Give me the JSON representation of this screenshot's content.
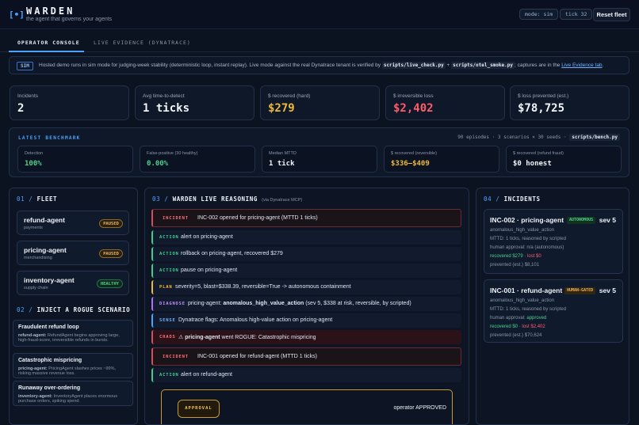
{
  "header": {
    "logo_glyph": "[•]",
    "brand": "WARDEN",
    "tagline": "the agent that governs your agents",
    "mode_pill": "mode: sim",
    "tick_pill": "tick 32",
    "reset_label": "Reset fleet"
  },
  "tabs": [
    {
      "label": "OPERATOR CONSOLE",
      "active": true
    },
    {
      "label": "LIVE EVIDENCE (DYNATRACE)",
      "active": false
    }
  ],
  "notice": {
    "badge": "SIM",
    "text_1": "Hosted demo runs in sim mode for judging-week stability (deterministic loop, instant replay). Live mode against the real Dynatrace tenant is verified by",
    "code_1": "scripts/live_check.py",
    "text_2": "+",
    "code_2": "scripts/otel_smoke.py",
    "text_3": "; captures are in the",
    "link": "Live Evidence tab",
    "text_4": "."
  },
  "stats": [
    {
      "label": "Incidents",
      "value": "2",
      "color": "#f1f4f9"
    },
    {
      "label": "Avg time-to-detect",
      "value": "1 ticks",
      "color": "#f1f4f9"
    },
    {
      "label": "$ recovered (hard)",
      "value": "$279",
      "color": "#f0b93a"
    },
    {
      "label": "$ irreversible loss",
      "value": "$2,402",
      "color": "#ff5c6c"
    },
    {
      "label": "$ loss prevented (est.)",
      "value": "$78,725",
      "color": "#f1f4f9"
    }
  ],
  "benchmark": {
    "title": "LATEST BENCHMARK",
    "meta": "90 episodes · 3 scenarios × 30 seeds ·",
    "script": "scripts/bench.py",
    "metrics": [
      {
        "label": "Detection",
        "value": "100%",
        "color": "#4bd08a"
      },
      {
        "label": "False-positive (30 healthy)",
        "value": "0.00%",
        "color": "#4bd08a"
      },
      {
        "label": "Median MTTD",
        "value": "1 tick",
        "color": "#f1f4f9"
      },
      {
        "label": "$ recovered (reversible)",
        "value": "$336–$409",
        "color": "#f0b93a"
      },
      {
        "label": "$ recovered (refund fraud)",
        "value": "$0 honest",
        "color": "#f1f4f9"
      }
    ]
  },
  "fleet": {
    "num": "01 /",
    "title": "FLEET",
    "agents": [
      {
        "name": "refund-agent",
        "domain": "payments",
        "status": "PAUSED"
      },
      {
        "name": "pricing-agent",
        "domain": "merchandising",
        "status": "PAUSED"
      },
      {
        "name": "inventory-agent",
        "domain": "supply chain",
        "status": "HEALTHY"
      }
    ]
  },
  "inject": {
    "num": "02 /",
    "title": "INJECT A ROGUE SCENARIO",
    "scenarios": [
      {
        "title": "Fraudulent refund loop",
        "agent": "refund-agent:",
        "desc": "RefundAgent begins approving large, high-fraud-score, irreversible refunds in bursts."
      },
      {
        "title": "Catastrophic mispricing",
        "agent": "pricing-agent:",
        "desc": "PricingAgent slashes prices ~99%, risking massive revenue loss."
      },
      {
        "title": "Runaway over-ordering",
        "agent": "inventory-agent:",
        "desc": "InventoryAgent places enormous purchase orders, spiking spend."
      }
    ]
  },
  "feed": {
    "num": "03 /",
    "title": "WARDEN LIVE REASONING",
    "subtitle": "(via Dynatrace MCP)",
    "events": [
      {
        "kind": "incident",
        "tag": "INCIDENT",
        "pre": "INC-002 opened for pricing-agent (MTTD 1 ticks)",
        "bold": "",
        "post": ""
      },
      {
        "kind": "action",
        "tag": "ACTION",
        "pre": "alert on pricing-agent",
        "bold": "",
        "post": ""
      },
      {
        "kind": "action",
        "tag": "ACTION",
        "pre": "rollback on pricing-agent, recovered $279",
        "bold": "",
        "post": ""
      },
      {
        "kind": "action",
        "tag": "ACTION",
        "pre": "pause on pricing-agent",
        "bold": "",
        "post": ""
      },
      {
        "kind": "plan",
        "tag": "PLAN",
        "pre": "severity=5, blast=$338.39, reversible=True -> autonomous containment",
        "bold": "",
        "post": ""
      },
      {
        "kind": "diagnose",
        "tag": "DIAGNOSE",
        "pre": "pricing-agent: ",
        "bold": "anomalous_high_value_action",
        "post": " (sev 5, $338 at risk, reversible, by scripted)"
      },
      {
        "kind": "sense",
        "tag": "SENSE",
        "pre": "Dynatrace flags: Anomalous high-value action on pricing-agent",
        "bold": "",
        "post": ""
      },
      {
        "kind": "chaos",
        "tag": "CHAOS",
        "pre": "⚠ ",
        "bold": "pricing-agent",
        "post": " went ROGUE: Catastrophic mispricing"
      },
      {
        "kind": "incident",
        "tag": "INCIDENT",
        "pre": "INC-001 opened for refund-agent (MTTD 1 ticks)",
        "bold": "",
        "post": ""
      },
      {
        "kind": "action",
        "tag": "ACTION",
        "pre": "alert on refund-agent",
        "bold": "",
        "post": ""
      }
    ],
    "approval_tag": "APPROVAL",
    "approval_text": "operator APPROVED"
  },
  "incidents": {
    "num": "04 /",
    "title": "INCIDENTS",
    "items": [
      {
        "title": "INC-002 · pricing-agent",
        "mode": "AUTONOMOUS",
        "sev": "sev 5",
        "type": "anomalous_high_value_action",
        "mttd": "MTTD: 1 ticks, reasoned by scripted",
        "approval_label": "human approval:",
        "approval_value": "n/a (autonomous)",
        "recovered": "recovered $279",
        "sep": " · ",
        "lost": "lost $0",
        "prevented": "prevented (est.) $8,101"
      },
      {
        "title": "INC-001 · refund-agent",
        "mode": "HUMAN-GATED",
        "sev": "sev 5",
        "type": "anomalous_high_value_action",
        "mttd": "MTTD: 1 ticks, reasoned by scripted",
        "approval_label": "human approval:",
        "approval_value": "approved",
        "recovered": "recovered $0",
        "sep": " · ",
        "lost": "lost $2,402",
        "prevented": "prevented (est.) $70,624"
      }
    ]
  }
}
